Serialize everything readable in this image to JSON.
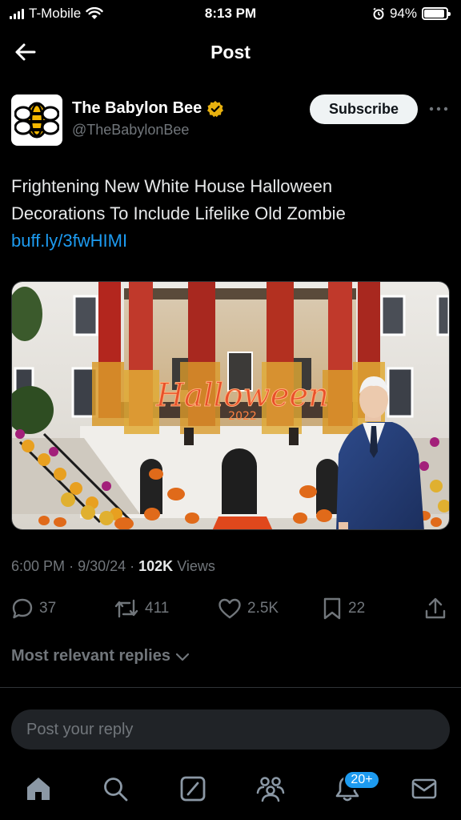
{
  "status_bar": {
    "carrier": "T-Mobile",
    "time": "8:13 PM",
    "battery_percent": "94%",
    "battery_level": 0.94,
    "icons": [
      "signal-icon",
      "wifi-icon",
      "alarm-icon",
      "battery-icon"
    ]
  },
  "header": {
    "title": "Post",
    "back_icon": "arrow-left-icon"
  },
  "post": {
    "author": {
      "name": "The Babylon Bee",
      "handle": "@TheBabylonBee",
      "verified_icon": "verified-badge-icon",
      "verified_color": "#e8b10f",
      "avatar": "babylon-bee-logo"
    },
    "subscribe_label": "Subscribe",
    "more_icon": "more-horizontal-icon",
    "text_line1": "Frightening New White House Halloween",
    "text_line2": "Decorations To Include Lifelike Old Zombie",
    "link": "buff.ly/3fwHIMI",
    "image": {
      "sign_text": "Halloween",
      "sign_year": "2022"
    },
    "meta": {
      "time": "6:00 PM",
      "date": "9/30/24",
      "views_count": "102K",
      "views_label": "Views"
    },
    "actions": {
      "replies": "37",
      "reposts": "411",
      "likes": "2.5K",
      "bookmarks": "22"
    }
  },
  "replies": {
    "filter_label": "Most relevant replies",
    "reply_placeholder": "Post your reply"
  },
  "tab_bar": {
    "tabs": [
      "home-icon",
      "search-icon",
      "grok-icon",
      "communities-icon",
      "notifications-icon",
      "messages-icon"
    ],
    "notification_badge": "20+"
  },
  "colors": {
    "background": "#000000",
    "text_primary": "#e7e9ea",
    "text_secondary": "#71767b",
    "accent": "#1d9bf0",
    "reply_box": "#202327",
    "divider": "#2f3336"
  }
}
